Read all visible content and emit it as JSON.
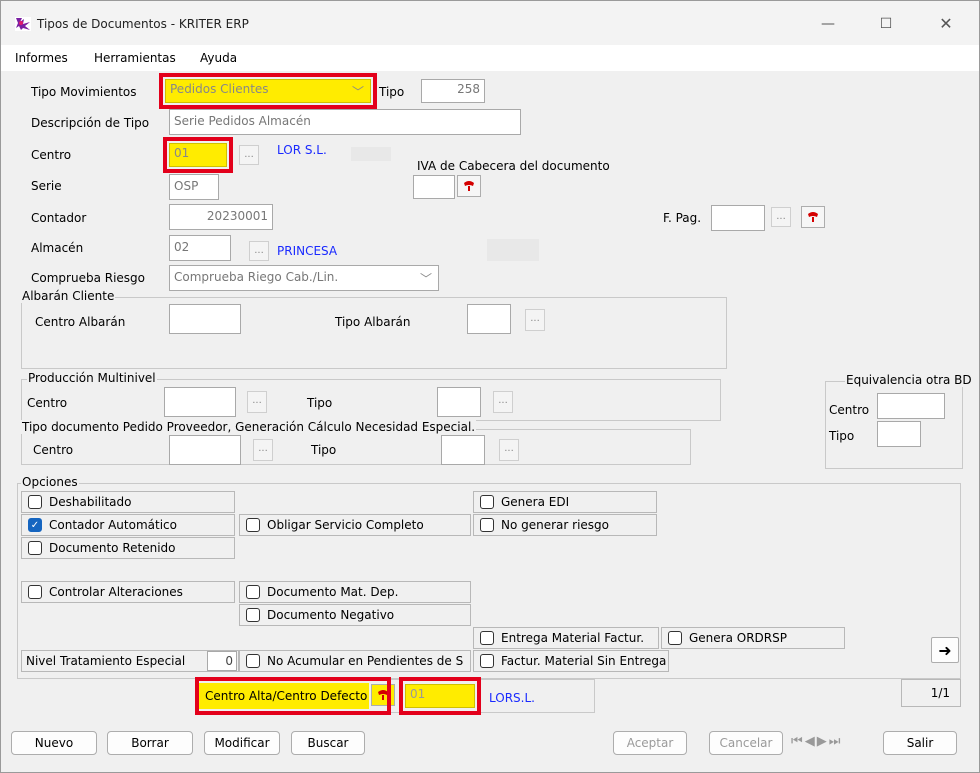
{
  "window": {
    "title": "Tipos de Documentos - KRITER ERP"
  },
  "menu": [
    "Informes",
    "Herramientas",
    "Ayuda"
  ],
  "form": {
    "tipo_movimientos": {
      "label": "Tipo Movimientos",
      "value": "Pedidos Clientes"
    },
    "tipo": {
      "label": "Tipo",
      "value": "258"
    },
    "descripcion": {
      "label": "Descripción de Tipo",
      "value": "Serie Pedidos Almacén"
    },
    "centro": {
      "label": "Centro",
      "value": "01",
      "name": "LOR S.L."
    },
    "iva_cabecera": {
      "label": "IVA de Cabecera del documento"
    },
    "serie": {
      "label": "Serie",
      "value": "OSP"
    },
    "contador": {
      "label": "Contador",
      "value": "20230001"
    },
    "fpag": {
      "label": "F. Pag."
    },
    "almacen": {
      "label": "Almacén",
      "value": "02",
      "name": "PRINCESA"
    },
    "comprueba_riesgo": {
      "label": "Comprueba Riesgo",
      "value": "Comprueba Riego Cab./Lin."
    }
  },
  "albaran": {
    "title": "Albarán Cliente",
    "centro_label": "Centro Albarán",
    "tipo_label": "Tipo Albarán"
  },
  "produccion": {
    "title": "Producción Multinivel",
    "centro_label": "Centro",
    "tipo_label": "Tipo"
  },
  "pedido_proveedor": {
    "title": "Tipo documento Pedido Proveedor, Generación Cálculo Necesidad Especial.",
    "centro_label": "Centro",
    "tipo_label": "Tipo"
  },
  "equivalencia": {
    "title": "Equivalencia otra BD",
    "centro_label": "Centro",
    "tipo_label": "Tipo"
  },
  "opciones": {
    "title": "Opciones",
    "deshabilitado": "Deshabilitado",
    "genera_edi": "Genera EDI",
    "contador_automatico": "Contador Automático",
    "obligar_servicio": "Obligar Servicio Completo",
    "no_generar_riesgo": "No generar riesgo",
    "documento_retenido": "Documento Retenido",
    "controlar_alteraciones": "Controlar Alteraciones",
    "documento_mat_dep": "Documento Mat. Dep.",
    "documento_negativo": "Documento Negativo",
    "entrega_material": "Entrega Material Factur.",
    "genera_ordrsp": "Genera ORDRSP",
    "nivel_tratamiento": "Nivel Tratamiento Especial",
    "nivel_valor": "0",
    "no_acumular": "No Acumular en Pendientes de S",
    "factur_sin_entrega": "Factur. Material Sin Entrega"
  },
  "centro_alta": {
    "label": "Centro Alta/Centro Defecto",
    "value": "01",
    "name": "LORS.L."
  },
  "pager": "1/1",
  "buttons": {
    "nuevo": "Nuevo",
    "borrar": "Borrar",
    "modificar": "Modificar",
    "buscar": "Buscar",
    "aceptar": "Aceptar",
    "cancelar": "Cancelar",
    "salir": "Salir"
  },
  "colors": {
    "highlight": "#ffec00",
    "annotation": "#e3001b",
    "link_text": "#1a2aff",
    "check": "#1565c0"
  }
}
